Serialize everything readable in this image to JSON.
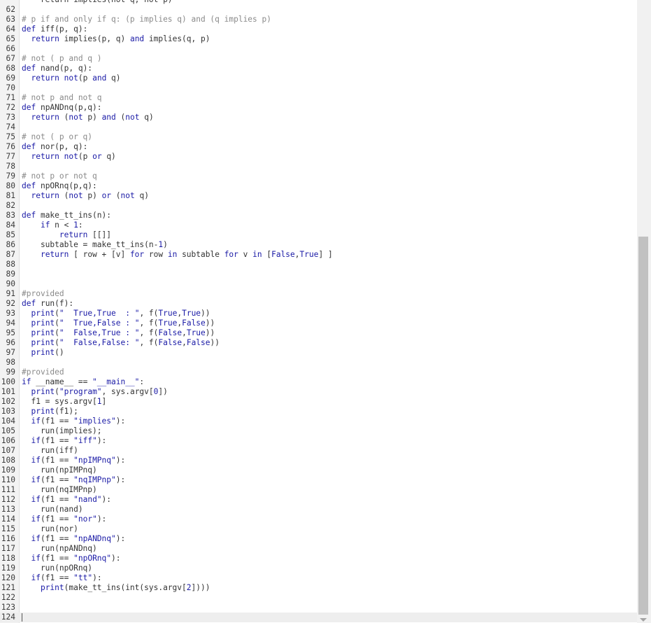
{
  "editor": {
    "top_partial": "    return implies(not q, not p)",
    "lines": [
      {
        "n": "62",
        "t": ""
      },
      {
        "n": "63",
        "t": "# p if and only if q: (p implies q) and (q implies p)"
      },
      {
        "n": "64",
        "t": "def iff(p, q):"
      },
      {
        "n": "65",
        "t": "  return implies(p, q) and implies(q, p)"
      },
      {
        "n": "66",
        "t": ""
      },
      {
        "n": "67",
        "t": "# not ( p and q )"
      },
      {
        "n": "68",
        "t": "def nand(p, q):"
      },
      {
        "n": "69",
        "t": "  return not(p and q)"
      },
      {
        "n": "70",
        "t": ""
      },
      {
        "n": "71",
        "t": "# not p and not q"
      },
      {
        "n": "72",
        "t": "def npANDnq(p,q):"
      },
      {
        "n": "73",
        "t": "  return (not p) and (not q)"
      },
      {
        "n": "74",
        "t": ""
      },
      {
        "n": "75",
        "t": "# not ( p or q)"
      },
      {
        "n": "76",
        "t": "def nor(p, q):"
      },
      {
        "n": "77",
        "t": "  return not(p or q)"
      },
      {
        "n": "78",
        "t": ""
      },
      {
        "n": "79",
        "t": "# not p or not q"
      },
      {
        "n": "80",
        "t": "def npORnq(p,q):"
      },
      {
        "n": "81",
        "t": "  return (not p) or (not q)"
      },
      {
        "n": "82",
        "t": ""
      },
      {
        "n": "83",
        "t": "def make_tt_ins(n):"
      },
      {
        "n": "84",
        "t": "    if n < 1:"
      },
      {
        "n": "85",
        "t": "        return [[]]"
      },
      {
        "n": "86",
        "t": "    subtable = make_tt_ins(n-1)"
      },
      {
        "n": "87",
        "t": "    return [ row + [v] for row in subtable for v in [False,True] ]"
      },
      {
        "n": "88",
        "t": ""
      },
      {
        "n": "89",
        "t": ""
      },
      {
        "n": "90",
        "t": ""
      },
      {
        "n": "91",
        "t": "#provided"
      },
      {
        "n": "92",
        "t": "def run(f):"
      },
      {
        "n": "93",
        "t": "  print(\"  True,True  : \", f(True,True))"
      },
      {
        "n": "94",
        "t": "  print(\"  True,False : \", f(True,False))"
      },
      {
        "n": "95",
        "t": "  print(\"  False,True : \", f(False,True))"
      },
      {
        "n": "96",
        "t": "  print(\"  False,False: \", f(False,False))"
      },
      {
        "n": "97",
        "t": "  print()"
      },
      {
        "n": "98",
        "t": ""
      },
      {
        "n": "99",
        "t": "#provided"
      },
      {
        "n": "100",
        "t": "if __name__ == \"__main__\":"
      },
      {
        "n": "101",
        "t": "  print(\"program\", sys.argv[0])"
      },
      {
        "n": "102",
        "t": "  f1 = sys.argv[1]"
      },
      {
        "n": "103",
        "t": "  print(f1);"
      },
      {
        "n": "104",
        "t": "  if(f1 == \"implies\"):"
      },
      {
        "n": "105",
        "t": "    run(implies);"
      },
      {
        "n": "106",
        "t": "  if(f1 == \"iff\"):"
      },
      {
        "n": "107",
        "t": "    run(iff)"
      },
      {
        "n": "108",
        "t": "  if(f1 == \"npIMPnq\"):"
      },
      {
        "n": "109",
        "t": "    run(npIMPnq)"
      },
      {
        "n": "110",
        "t": "  if(f1 == \"nqIMPnp\"):"
      },
      {
        "n": "111",
        "t": "    run(nqIMPnp)"
      },
      {
        "n": "112",
        "t": "  if(f1 == \"nand\"):"
      },
      {
        "n": "113",
        "t": "    run(nand)"
      },
      {
        "n": "114",
        "t": "  if(f1 == \"nor\"):"
      },
      {
        "n": "115",
        "t": "    run(nor)"
      },
      {
        "n": "116",
        "t": "  if(f1 == \"npANDnq\"):"
      },
      {
        "n": "117",
        "t": "    run(npANDnq)"
      },
      {
        "n": "118",
        "t": "  if(f1 == \"npORnq\"):"
      },
      {
        "n": "119",
        "t": "    run(npORnq)"
      },
      {
        "n": "120",
        "t": "  if(f1 == \"tt\"):"
      },
      {
        "n": "121",
        "t": "    print(make_tt_ins(int(sys.argv[2])))"
      },
      {
        "n": "122",
        "t": ""
      },
      {
        "n": "123",
        "t": ""
      },
      {
        "n": "124",
        "t": ""
      }
    ],
    "active_line": "124",
    "colors": {
      "keyword": "#1a1aa6",
      "comment": "#8a8a8a",
      "text": "#333333",
      "gutter_bg": "#f3f3f3",
      "active_line_bg": "#eeeeee"
    }
  },
  "scrollbar": {
    "scroll_fraction": 0.62,
    "down_arrow_icon": "triangle-down-icon"
  }
}
